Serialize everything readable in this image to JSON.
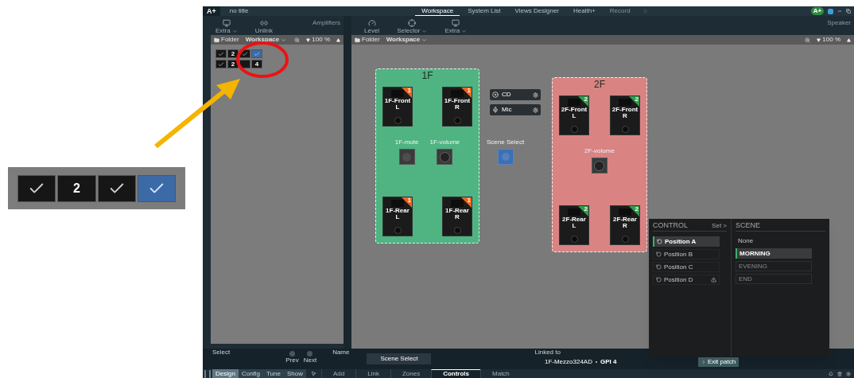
{
  "title_bar": {
    "logo": "A+",
    "document_title": "no title",
    "user_badge": "A+",
    "tabs": [
      {
        "label": "Workspace",
        "selected": true,
        "disabled": false
      },
      {
        "label": "System List",
        "selected": false,
        "disabled": false
      },
      {
        "label": "Views Designer",
        "selected": false,
        "disabled": false
      },
      {
        "label": "Health+",
        "selected": false,
        "disabled": false
      },
      {
        "label": "Record",
        "selected": false,
        "disabled": true
      }
    ]
  },
  "left_toolbar": {
    "tools": [
      {
        "kind": "display",
        "label": "Extra",
        "dropdown": true
      },
      {
        "kind": "unlink",
        "label": "Unlink",
        "dropdown": false
      }
    ],
    "section": "Amplifiers"
  },
  "right_toolbar": {
    "tools": [
      {
        "kind": "level",
        "label": "Level",
        "dropdown": false
      },
      {
        "kind": "selector",
        "label": "Selector",
        "dropdown": true
      },
      {
        "kind": "display",
        "label": "Extra",
        "dropdown": true
      }
    ],
    "section": "Speaker"
  },
  "left_panel": {
    "folder": "Folder",
    "workspace": "Workspace",
    "zoom": "100 %",
    "widget_rows": [
      [
        {
          "kind": "check",
          "selected": false
        },
        {
          "kind": "number",
          "text": "2",
          "selected": false
        },
        {
          "kind": "check",
          "selected": false
        },
        {
          "kind": "check",
          "selected": true
        }
      ],
      [
        {
          "kind": "check",
          "selected": false
        },
        {
          "kind": "number",
          "text": "2",
          "selected": false
        },
        {
          "kind": "blank",
          "selected": false
        },
        {
          "kind": "number",
          "text": "4",
          "selected": false
        }
      ]
    ]
  },
  "right_panel": {
    "folder": "Folder",
    "workspace": "Workspace",
    "zoom": "100 %"
  },
  "canvas": {
    "zones": [
      {
        "title": "1F",
        "color": "#4fb481",
        "speakers": [
          {
            "name": "1F-Front L",
            "badge": "1",
            "color": "#f0641e"
          },
          {
            "name": "1F-Front R",
            "badge": "1",
            "color": "#f0641e"
          },
          {
            "name": "1F-Rear L",
            "badge": "1",
            "color": "#f0641e"
          },
          {
            "name": "1F-Rear R",
            "badge": "1",
            "color": "#f0641e"
          }
        ],
        "controls": [
          {
            "kind": "button",
            "label": "1F-mute"
          },
          {
            "kind": "knob",
            "label": "1F-volume"
          }
        ]
      },
      {
        "title": "2F",
        "color": "#d98383",
        "speakers": [
          {
            "name": "2F-Front L",
            "badge": "2",
            "color": "#2e9e4a"
          },
          {
            "name": "2F-Front R",
            "badge": "2",
            "color": "#2e9e4a"
          },
          {
            "name": "2F-Rear L",
            "badge": "2",
            "color": "#2e9e4a"
          },
          {
            "name": "2F-Rear R",
            "badge": "2",
            "color": "#2e9e4a"
          }
        ],
        "controls": [
          {
            "kind": "knob",
            "label": "2F-volume"
          }
        ]
      }
    ],
    "sources": [
      {
        "kind": "cd",
        "label": "CD"
      },
      {
        "kind": "mic",
        "label": "Mic"
      }
    ],
    "scene_control": {
      "label": "Scene Select"
    }
  },
  "popup": {
    "control_title": "CONTROL",
    "set_link": "Set >",
    "positions": [
      {
        "label": "Position A",
        "selected": true,
        "warning": false
      },
      {
        "label": "Position B",
        "selected": false,
        "warning": false
      },
      {
        "label": "Position C",
        "selected": false,
        "warning": false
      },
      {
        "label": "Position D",
        "selected": false,
        "warning": true
      }
    ],
    "scene_title": "SCENE",
    "scenes": [
      {
        "label": "None",
        "selected": false,
        "disabled": false
      },
      {
        "label": "MORNING",
        "selected": true,
        "disabled": false
      },
      {
        "label": "EVENING",
        "selected": false,
        "disabled": true
      },
      {
        "label": "END",
        "selected": false,
        "disabled": true
      }
    ],
    "exit_button": "Exit patch"
  },
  "bottom_info": {
    "select_label": "Select",
    "prev": "Prev",
    "next": "Next",
    "name_label": "Name",
    "name_value": "Scene Select",
    "linked_label": "Linked to",
    "linked_device": "1F-Mezzo324AD",
    "linked_port": "GPI 4"
  },
  "mode_tabs": [
    {
      "label": "Design",
      "selected": true
    },
    {
      "label": "Config",
      "selected": false
    },
    {
      "label": "Tune",
      "selected": false
    },
    {
      "label": "Show",
      "selected": false
    }
  ],
  "view_tabs": [
    {
      "label": "Add",
      "selected": false
    },
    {
      "label": "Link",
      "selected": false
    },
    {
      "label": "Zones",
      "selected": false
    },
    {
      "label": "Controls",
      "selected": true
    },
    {
      "label": "Match",
      "selected": false
    }
  ],
  "zoom_inset": {
    "cells": [
      {
        "kind": "check",
        "selected": false
      },
      {
        "kind": "number",
        "text": "2",
        "selected": false
      },
      {
        "kind": "check",
        "selected": false
      },
      {
        "kind": "check",
        "selected": true
      }
    ]
  }
}
